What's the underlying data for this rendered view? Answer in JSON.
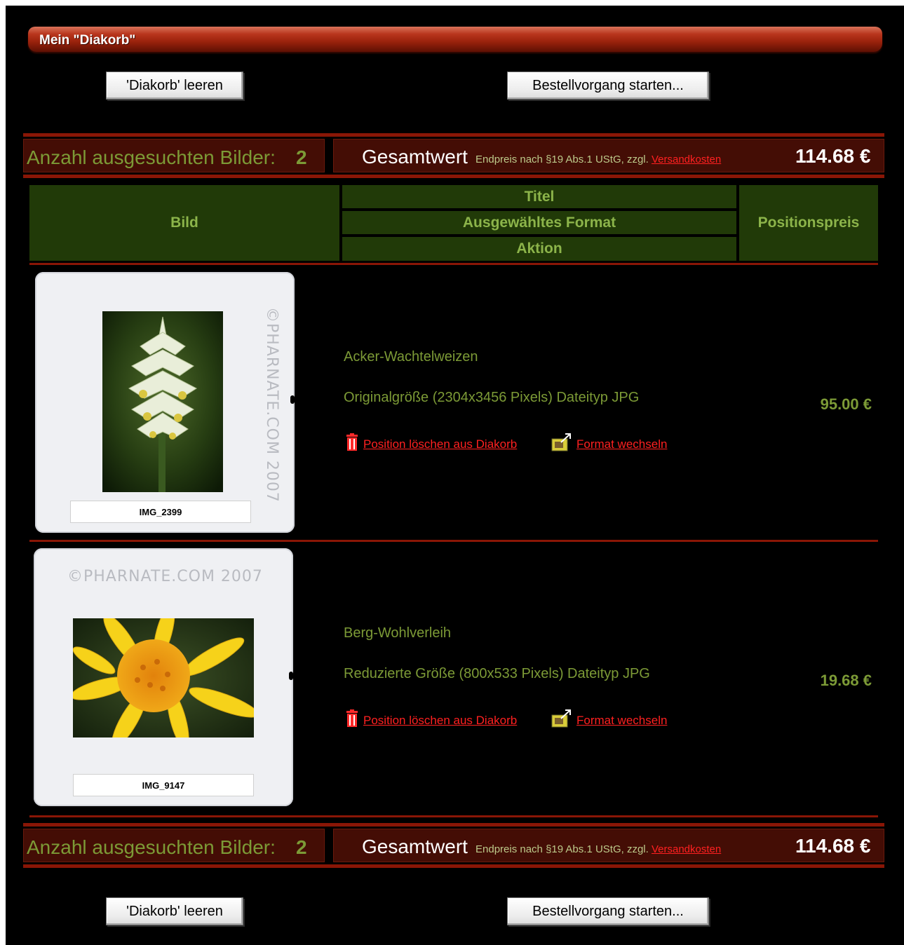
{
  "header": {
    "title": "Mein \"Diakorb\""
  },
  "buttons": {
    "clear": "'Diakorb' leeren",
    "order": "Bestellvorgang starten..."
  },
  "summary": {
    "count_label": "Anzahl ausgesuchten Bilder:",
    "count": "2",
    "total_label": "Gesamtwert",
    "note": "Endpreis nach §19 Abs.1 UStG, zzgl.",
    "shipping_link": "Versandkosten",
    "total": "114.68  €"
  },
  "table": {
    "col_image": "Bild",
    "col_title": "Titel",
    "col_format": "Ausgewähltes Format",
    "col_action": "Aktion",
    "col_price": "Positionspreis"
  },
  "actions": {
    "delete": "Position löschen aus Diakorb",
    "change": "Format wechseln"
  },
  "items": [
    {
      "watermark": "©PHARNATE.COM 2007",
      "caption": "IMG_2399",
      "title": "Acker-Wachtelweizen",
      "format": "Originalgröße (2304x3456 Pixels) Dateityp JPG",
      "price": "95.00 €"
    },
    {
      "watermark": "©PHARNATE.COM 2007",
      "caption": "IMG_9147",
      "title": "Berg-Wohlverleih",
      "format": "Reduzierte Größe (800x533 Pixels) Dateityp JPG",
      "price": "19.68 €"
    }
  ],
  "colors": {
    "accent_red": "#8a1606",
    "link_red": "#ff2020",
    "text_green": "#7c9a36",
    "header_green": "#213a08"
  }
}
